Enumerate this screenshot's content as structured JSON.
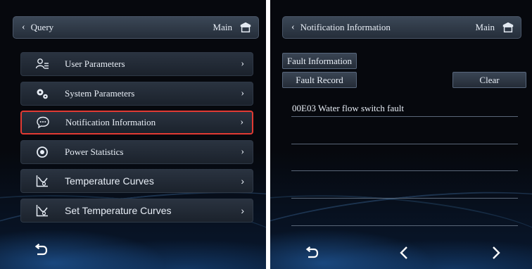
{
  "left_screen": {
    "title": "Query",
    "main_label": "Main",
    "menu": [
      {
        "label": "User Parameters",
        "icon": "user-parameters-icon"
      },
      {
        "label": "System Parameters",
        "icon": "gears-icon"
      },
      {
        "label": "Notification Information",
        "icon": "chat-bubble-icon",
        "selected": true
      },
      {
        "label": "Power Statistics",
        "icon": "power-icon"
      },
      {
        "label": "Temperature Curves",
        "icon": "curve-icon"
      },
      {
        "label": "Set Temperature Curves",
        "icon": "curve-icon"
      }
    ]
  },
  "right_screen": {
    "title": "Notification Information",
    "main_label": "Main",
    "fault_information_label": "Fault Information",
    "fault_record_label": "Fault Record",
    "clear_label": "Clear",
    "records": [
      "00E03 Water flow switch fault"
    ]
  },
  "colors": {
    "selection_border": "#e23a33",
    "background": "#06080d",
    "bar": "#2a3340"
  }
}
